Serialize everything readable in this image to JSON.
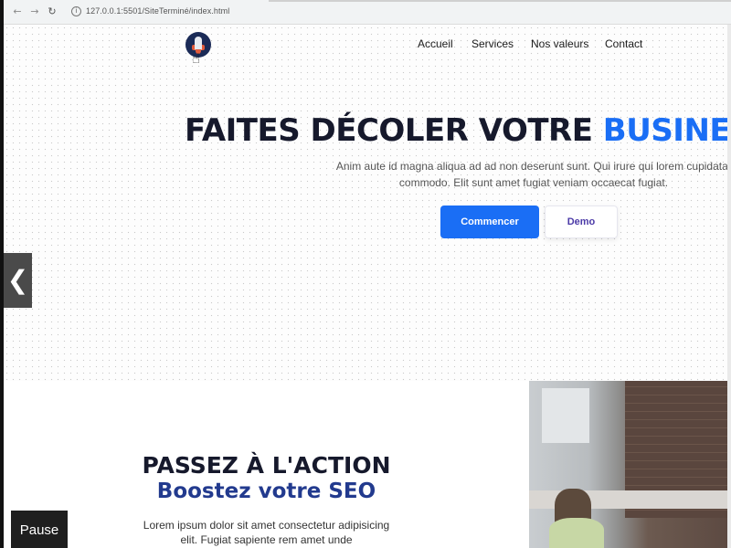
{
  "browser": {
    "url": "127.0.0.1:5501/SiteTerminé/index.html",
    "back_icon": "arrow-left",
    "forward_icon": "arrow-right",
    "reload_icon": "reload",
    "info_icon": "info-circle"
  },
  "header": {
    "logo_icon": "rocket-logo",
    "nav": [
      "Accueil",
      "Services",
      "Nos valeurs",
      "Contact"
    ]
  },
  "hero": {
    "title_main": "FAITES DÉCOLER VOTRE ",
    "title_accent": "BUSINESS",
    "subtitle": "Anim aute id magna aliqua ad ad non deserunt sunt. Qui irure qui lorem cupidatat commodo. Elit sunt amet fugiat veniam occaecat fugiat.",
    "primary_button": "Commencer",
    "secondary_button": "Demo",
    "carousel_prev_icon": "chevron-left"
  },
  "section2": {
    "title": "PASSEZ À L'ACTION",
    "subtitle": "Boostez votre SEO",
    "text": "Lorem ipsum dolor sit amet consectetur adipisicing elit. Fugiat sapiente rem amet unde"
  },
  "video": {
    "pause_label": "Pause"
  },
  "colors": {
    "accent": "#1a6ef5",
    "dark_text": "#16192c",
    "seo_blue": "#223a8e",
    "demo_text": "#4b3aa7"
  }
}
